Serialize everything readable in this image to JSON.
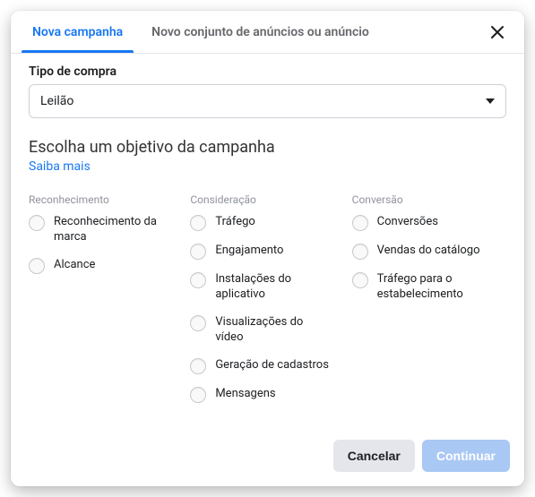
{
  "tabs": {
    "new_campaign": "Nova campanha",
    "new_adset_or_ad": "Novo conjunto de anúncios ou anúncio"
  },
  "purchase_type": {
    "label": "Tipo de compra",
    "value": "Leilão"
  },
  "objective": {
    "title": "Escolha um objetivo da campanha",
    "learn_more": "Saiba mais",
    "columns": {
      "awareness": {
        "header": "Reconhecimento",
        "options": [
          "Reconhecimento da marca",
          "Alcance"
        ]
      },
      "consideration": {
        "header": "Consideração",
        "options": [
          "Tráfego",
          "Engajamento",
          "Instalações do aplicativo",
          "Visualizações do vídeo",
          "Geração de cadastros",
          "Mensagens"
        ]
      },
      "conversion": {
        "header": "Conversão",
        "options": [
          "Conversões",
          "Vendas do catálogo",
          "Tráfego para o estabelecimento"
        ]
      }
    }
  },
  "footer": {
    "cancel": "Cancelar",
    "continue": "Continuar"
  }
}
